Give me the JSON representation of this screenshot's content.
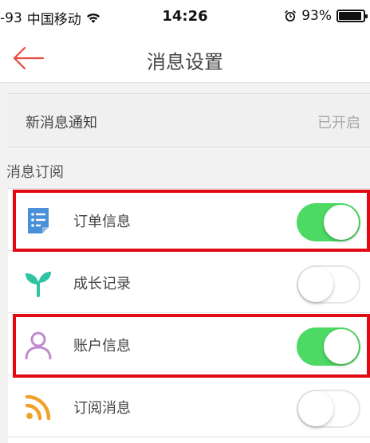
{
  "status_bar": {
    "signal": "-93",
    "carrier": "中国移动",
    "time": "14:26",
    "battery_percent": "93%",
    "battery_level": 0.93
  },
  "nav": {
    "title": "消息设置",
    "back_icon": "back-arrow-icon"
  },
  "notification": {
    "label": "新消息通知",
    "value": "已开启"
  },
  "subscription": {
    "header": "消息订阅",
    "items": [
      {
        "label": "订单信息",
        "icon": "order-document-icon",
        "enabled": true,
        "icon_color": "#4a90d9"
      },
      {
        "label": "成长记录",
        "icon": "sprout-icon",
        "enabled": false,
        "icon_color": "#2fc3a3"
      },
      {
        "label": "账户信息",
        "icon": "user-icon",
        "enabled": true,
        "icon_color": "#c08ad0"
      },
      {
        "label": "订阅消息",
        "icon": "rss-feed-icon",
        "enabled": false,
        "icon_color": "#f0a32b"
      }
    ]
  },
  "colors": {
    "switch_on": "#4cd964",
    "highlight": "#e00a14",
    "back_arrow": "#e74c3c"
  }
}
